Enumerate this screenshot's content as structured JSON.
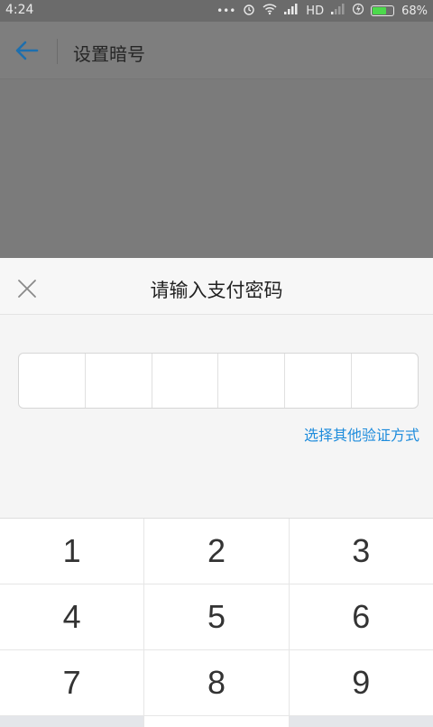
{
  "status_bar": {
    "time": "4:24",
    "network": "HD",
    "battery_percent": "68%",
    "battery_level": 0.68
  },
  "header": {
    "title": "设置暗号"
  },
  "sheet": {
    "title": "请输入支付密码",
    "alt_verify_link": "选择其他验证方式",
    "password_cells": 6
  },
  "keypad": {
    "rows": [
      [
        "1",
        "2",
        "3"
      ],
      [
        "4",
        "5",
        "6"
      ],
      [
        "7",
        "8",
        "9"
      ]
    ]
  },
  "colors": {
    "link": "#1e8cdc",
    "back_arrow": "#1e6fae",
    "battery": "#4cd94c"
  }
}
